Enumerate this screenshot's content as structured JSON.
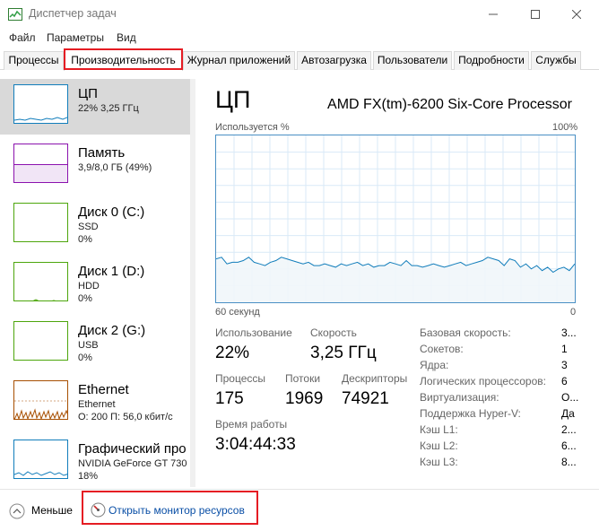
{
  "window": {
    "title": "Диспетчер задач"
  },
  "menu": [
    "Файл",
    "Параметры",
    "Вид"
  ],
  "tabs": [
    {
      "label": "Процессы",
      "active": false
    },
    {
      "label": "Производительность",
      "active": true
    },
    {
      "label": "Журнал приложений",
      "active": false
    },
    {
      "label": "Автозагрузка",
      "active": false
    },
    {
      "label": "Пользователи",
      "active": false
    },
    {
      "label": "Подробности",
      "active": false
    },
    {
      "label": "Службы",
      "active": false
    }
  ],
  "sidebar": {
    "items": [
      {
        "title": "ЦП",
        "sub1": "22% 3,25 ГГц",
        "sub2": "",
        "color": "#117dbb",
        "selected": true
      },
      {
        "title": "Память",
        "sub1": "3,9/8,0 ГБ (49%)",
        "sub2": "",
        "color": "#8b12ae",
        "selected": false
      },
      {
        "title": "Диск 0 (C:)",
        "sub1": "SSD",
        "sub2": "0%",
        "color": "#4da60c",
        "selected": false
      },
      {
        "title": "Диск 1 (D:)",
        "sub1": "HDD",
        "sub2": "0%",
        "color": "#4da60c",
        "selected": false
      },
      {
        "title": "Диск 2 (G:)",
        "sub1": "USB",
        "sub2": "0%",
        "color": "#4da60c",
        "selected": false
      },
      {
        "title": "Ethernet",
        "sub1": "Ethernet",
        "sub2": "О: 200  П: 56,0 кбит/с",
        "color": "#a74f01",
        "selected": false
      },
      {
        "title": "Графический про",
        "sub1": "NVIDIA GeForce GT 730",
        "sub2": "18%",
        "color": "#117dbb",
        "selected": false
      }
    ]
  },
  "main": {
    "title": "ЦП",
    "processor": "AMD FX(tm)-6200 Six-Core Processor",
    "graph_top_left": "Используется %",
    "graph_top_right": "100%",
    "graph_bottom_left": "60 секунд",
    "graph_bottom_right": "0",
    "stats": {
      "usage_label": "Использование",
      "usage_value": "22%",
      "speed_label": "Скорость",
      "speed_value": "3,25 ГГц",
      "processes_label": "Процессы",
      "processes_value": "175",
      "threads_label": "Потоки",
      "threads_value": "1969",
      "handles_label": "Дескрипторы",
      "handles_value": "74921",
      "uptime_label": "Время работы",
      "uptime_value": "3:04:44:33"
    },
    "specs": [
      {
        "label": "Базовая скорость:",
        "value": "3..."
      },
      {
        "label": "Сокетов:",
        "value": "1"
      },
      {
        "label": "Ядра:",
        "value": "3"
      },
      {
        "label": "Логических процессоров:",
        "value": "6"
      },
      {
        "label": "Виртуализация:",
        "value": "О..."
      },
      {
        "label": "Поддержка Hyper-V:",
        "value": "Да"
      },
      {
        "label": "Кэш L1:",
        "value": "2..."
      },
      {
        "label": "Кэш L2:",
        "value": "6..."
      },
      {
        "label": "Кэш L3:",
        "value": "8..."
      }
    ],
    "cpu_history_percent": [
      26,
      27,
      23,
      24,
      24,
      25,
      27,
      24,
      23,
      22,
      24,
      25,
      27,
      26,
      25,
      24,
      23,
      24,
      22,
      22,
      23,
      22,
      21,
      23,
      22,
      23,
      24,
      22,
      23,
      21,
      22,
      22,
      24,
      23,
      22,
      25,
      22,
      22,
      21,
      22,
      23,
      22,
      21,
      22,
      23,
      24,
      22,
      23,
      24,
      25,
      27,
      26,
      25,
      22,
      26,
      25,
      21,
      23,
      20,
      22,
      19,
      21,
      18,
      20,
      21,
      19,
      23
    ]
  },
  "footer": {
    "fewer_label": "Меньше",
    "monitor_link": "Открыть монитор ресурсов"
  },
  "colors": {
    "cpu": "#117dbb",
    "memory": "#8b12ae",
    "disk": "#4da60c",
    "ethernet": "#a74f01",
    "highlight": "#e51c23"
  }
}
